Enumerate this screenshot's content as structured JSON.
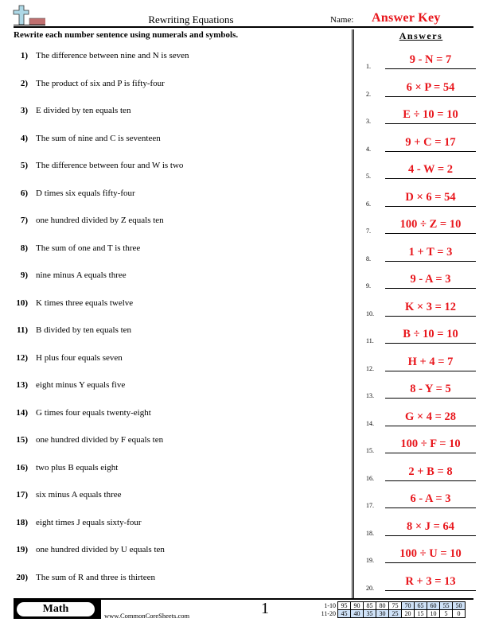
{
  "header": {
    "title": "Rewriting Equations",
    "name_label": "Name:",
    "name_value": "Answer Key",
    "logo_icon": "plus-sign-logo-icon"
  },
  "instructions": "Rewrite each number sentence using numerals and symbols.",
  "answers_heading": "Answers",
  "questions": [
    {
      "num": "1)",
      "text": "The difference between nine and N is seven"
    },
    {
      "num": "2)",
      "text": "The product of six and P is fifty-four"
    },
    {
      "num": "3)",
      "text": "E divided by ten equals ten"
    },
    {
      "num": "4)",
      "text": "The sum of nine and C is seventeen"
    },
    {
      "num": "5)",
      "text": "The difference between four and W is two"
    },
    {
      "num": "6)",
      "text": "D times six equals fifty-four"
    },
    {
      "num": "7)",
      "text": "one hundred divided by Z equals ten"
    },
    {
      "num": "8)",
      "text": "The sum of one and T is three"
    },
    {
      "num": "9)",
      "text": "nine minus A equals three"
    },
    {
      "num": "10)",
      "text": "K times three equals twelve"
    },
    {
      "num": "11)",
      "text": "B divided by ten equals ten"
    },
    {
      "num": "12)",
      "text": "H plus four equals seven"
    },
    {
      "num": "13)",
      "text": "eight minus Y equals five"
    },
    {
      "num": "14)",
      "text": "G times four equals twenty-eight"
    },
    {
      "num": "15)",
      "text": "one hundred divided by F equals ten"
    },
    {
      "num": "16)",
      "text": "two plus B equals eight"
    },
    {
      "num": "17)",
      "text": "six minus A equals three"
    },
    {
      "num": "18)",
      "text": "eight times J equals sixty-four"
    },
    {
      "num": "19)",
      "text": "one hundred divided by U equals ten"
    },
    {
      "num": "20)",
      "text": "The sum of R and three is thirteen"
    }
  ],
  "answers": [
    {
      "num": "1.",
      "text": "9 - N = 7"
    },
    {
      "num": "2.",
      "text": "6 × P = 54"
    },
    {
      "num": "3.",
      "text": "E ÷ 10 = 10"
    },
    {
      "num": "4.",
      "text": "9 + C = 17"
    },
    {
      "num": "5.",
      "text": "4 - W = 2"
    },
    {
      "num": "6.",
      "text": "D × 6 = 54"
    },
    {
      "num": "7.",
      "text": "100 ÷ Z = 10"
    },
    {
      "num": "8.",
      "text": "1 + T = 3"
    },
    {
      "num": "9.",
      "text": "9 - A = 3"
    },
    {
      "num": "10.",
      "text": "K × 3 = 12"
    },
    {
      "num": "11.",
      "text": "B ÷ 10 = 10"
    },
    {
      "num": "12.",
      "text": "H + 4 = 7"
    },
    {
      "num": "13.",
      "text": "8 - Y = 5"
    },
    {
      "num": "14.",
      "text": "G × 4 = 28"
    },
    {
      "num": "15.",
      "text": "100 ÷ F = 10"
    },
    {
      "num": "16.",
      "text": "2 + B = 8"
    },
    {
      "num": "17.",
      "text": "6 - A = 3"
    },
    {
      "num": "18.",
      "text": "8 × J = 64"
    },
    {
      "num": "19.",
      "text": "100 ÷ U = 10"
    },
    {
      "num": "20.",
      "text": "R + 3 = 13"
    }
  ],
  "footer": {
    "subject": "Math",
    "website": "www.CommonCoreSheets.com",
    "page_number": "1",
    "score_table": [
      {
        "label": "1-10",
        "cells": [
          "95",
          "90",
          "85",
          "80",
          "75",
          "70",
          "65",
          "60",
          "55",
          "50"
        ],
        "highlight": [
          false,
          false,
          false,
          false,
          false,
          true,
          true,
          true,
          true,
          true
        ]
      },
      {
        "label": "11-20",
        "cells": [
          "45",
          "40",
          "35",
          "30",
          "25",
          "20",
          "15",
          "10",
          "5",
          "0"
        ],
        "highlight": [
          true,
          true,
          true,
          true,
          true,
          false,
          false,
          false,
          false,
          false
        ]
      }
    ]
  },
  "colors": {
    "answer_red": "#e8161c",
    "score_highlight": "#cfe2f8",
    "logo_plus": "#add8e6",
    "logo_bar": "#c07070"
  }
}
